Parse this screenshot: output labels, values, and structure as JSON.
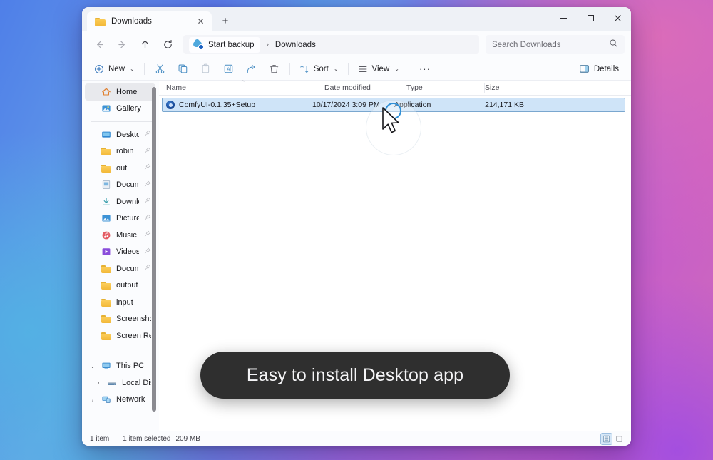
{
  "window": {
    "tab": {
      "title": "Downloads",
      "close_label": "✕",
      "new_tab_label": "+"
    },
    "controls": {
      "minimize": "minimize",
      "maximize": "maximize",
      "close": "close"
    }
  },
  "addressbar": {
    "back": "back-arrow",
    "forward": "forward-arrow",
    "up": "up-arrow",
    "refresh": "refresh",
    "breadcrumb": [
      {
        "label": "Start backup",
        "icon": "onedrive-backup-icon"
      },
      {
        "label": "Downloads",
        "icon": ""
      }
    ],
    "separator": "›",
    "search": {
      "placeholder": "Search Downloads",
      "icon": "search-icon"
    }
  },
  "commandbar": {
    "new": {
      "label": "New",
      "chevron": "⌄"
    },
    "cut": "cut-icon",
    "copy": "copy-icon",
    "paste": "paste-icon",
    "rename": "rename-icon",
    "share": "share-icon",
    "delete": "delete-icon",
    "sort": {
      "label": "Sort",
      "chevron": "⌄"
    },
    "view": {
      "label": "View",
      "chevron": "⌄"
    },
    "more": "···",
    "details": {
      "label": "Details",
      "icon": "details-pane-icon"
    }
  },
  "sidebar": {
    "items": [
      {
        "label": "Home",
        "icon": "home-icon",
        "pinned": false,
        "selected": true,
        "chevron": ""
      },
      {
        "label": "Gallery",
        "icon": "gallery-icon",
        "pinned": false,
        "selected": false,
        "chevron": ""
      },
      {
        "label": "Desktop",
        "icon": "desktop-icon",
        "pinned": true,
        "selected": false,
        "chevron": ""
      },
      {
        "label": "robin",
        "icon": "folder-icon",
        "pinned": true,
        "selected": false,
        "chevron": ""
      },
      {
        "label": "out",
        "icon": "folder-icon",
        "pinned": true,
        "selected": false,
        "chevron": ""
      },
      {
        "label": "Documents",
        "icon": "documents-icon",
        "pinned": true,
        "selected": false,
        "chevron": ""
      },
      {
        "label": "Downloads",
        "icon": "downloads-icon",
        "pinned": true,
        "selected": false,
        "chevron": ""
      },
      {
        "label": "Pictures",
        "icon": "pictures-icon",
        "pinned": true,
        "selected": false,
        "chevron": ""
      },
      {
        "label": "Music",
        "icon": "music-icon",
        "pinned": true,
        "selected": false,
        "chevron": ""
      },
      {
        "label": "Videos",
        "icon": "videos-icon",
        "pinned": true,
        "selected": false,
        "chevron": ""
      },
      {
        "label": "Documents",
        "icon": "folder-icon",
        "pinned": true,
        "selected": false,
        "chevron": ""
      },
      {
        "label": "output",
        "icon": "folder-icon",
        "pinned": false,
        "selected": false,
        "chevron": ""
      },
      {
        "label": "input",
        "icon": "folder-icon",
        "pinned": false,
        "selected": false,
        "chevron": ""
      },
      {
        "label": "Screenshots",
        "icon": "folder-icon",
        "pinned": false,
        "selected": false,
        "chevron": ""
      },
      {
        "label": "Screen Recordings",
        "icon": "folder-icon",
        "pinned": false,
        "selected": false,
        "chevron": ""
      }
    ],
    "tree": [
      {
        "label": "This PC",
        "icon": "this-pc-icon",
        "chevron": "⌄",
        "indent": 0
      },
      {
        "label": "Local Disk (C:)",
        "icon": "local-disk-icon",
        "chevron": "›",
        "indent": 1
      },
      {
        "label": "Network",
        "icon": "network-icon",
        "chevron": "›",
        "indent": 0
      }
    ]
  },
  "filelist": {
    "columns": [
      {
        "key": "name",
        "label": "Name",
        "sort": "ascending"
      },
      {
        "key": "date",
        "label": "Date modified",
        "sort": ""
      },
      {
        "key": "type",
        "label": "Type",
        "sort": ""
      },
      {
        "key": "size",
        "label": "Size",
        "sort": ""
      }
    ],
    "sort_caret": "⌃",
    "rows": [
      {
        "name": "ComfyUI-0.1.35+Setup",
        "date": "10/17/2024 3:09 PM",
        "type": "Application",
        "size": "214,171 KB",
        "icon": "comfyui-app-icon",
        "selected": true
      }
    ]
  },
  "statusbar": {
    "item_count": "1 item",
    "selection": "1 item selected",
    "selection_size": "209 MB",
    "views": [
      {
        "name": "details-view",
        "active": true
      },
      {
        "name": "large-icons-view",
        "active": false
      }
    ]
  },
  "overlay": {
    "caption": "Easy to install Desktop app"
  },
  "colors": {
    "accent": "#1a5fc0",
    "selection_fill": "#cfe4f8",
    "selection_border": "#7aa7cf",
    "caption_bg": "#2f2f2f",
    "window_bg": "#fbfcfe",
    "folder_yellow": "#f2b838"
  }
}
